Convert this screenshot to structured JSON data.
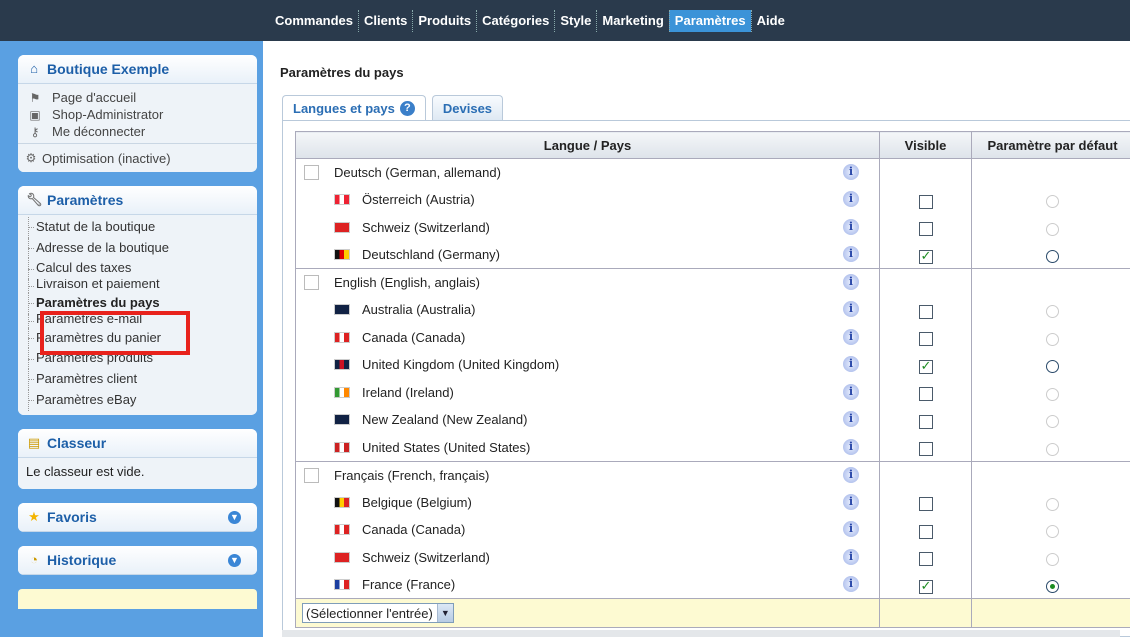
{
  "nav": {
    "items": [
      "Commandes",
      "Clients",
      "Produits",
      "Catégories",
      "Style",
      "Marketing",
      "Paramètres",
      "Aide"
    ],
    "active": "Paramètres"
  },
  "sidebar": {
    "shop": {
      "title": "Boutique Exemple",
      "links": [
        "Page d'accueil",
        "Shop-Administrator",
        "Me déconnecter"
      ],
      "optimisation": "Optimisation (inactive)"
    },
    "settings": {
      "title": "Paramètres",
      "items": [
        "Statut de la boutique",
        "Adresse de la boutique",
        "Calcul des taxes",
        "Livraison et paiement",
        "Paramètres du pays",
        "Paramètres e-mail",
        "Paramètres du panier",
        "Paramètres produits",
        "Paramètres client",
        "Paramètres eBay"
      ]
    },
    "binder": {
      "title": "Classeur",
      "empty_text": "Le classeur est vide."
    },
    "favorites": {
      "title": "Favoris"
    },
    "history": {
      "title": "Historique"
    }
  },
  "main": {
    "title": "Paramètres du pays",
    "tabs": [
      "Langues et pays",
      "Devises"
    ],
    "table": {
      "headers": [
        "Langue / Pays",
        "Visible",
        "Paramètre par défaut"
      ],
      "groups": [
        {
          "language": "Deutsch (German, allemand)",
          "countries": [
            {
              "name": "Österreich (Austria)",
              "visible": false,
              "default": false,
              "enabled": false,
              "flag": [
                "#e23",
                "#fff",
                "#e23"
              ]
            },
            {
              "name": "Schweiz (Switzerland)",
              "visible": false,
              "default": false,
              "enabled": false,
              "flag": [
                "#d22",
                "#d22",
                "#d22"
              ]
            },
            {
              "name": "Deutschland (Germany)",
              "visible": true,
              "default": false,
              "enabled": true,
              "flag": [
                "#111",
                "#d00",
                "#fc0"
              ]
            }
          ]
        },
        {
          "language": "English (English, anglais)",
          "countries": [
            {
              "name": "Australia (Australia)",
              "visible": false,
              "default": false,
              "enabled": false,
              "flag": [
                "#124",
                "#124",
                "#124"
              ]
            },
            {
              "name": "Canada (Canada)",
              "visible": false,
              "default": false,
              "enabled": false,
              "flag": [
                "#d22",
                "#fff",
                "#d22"
              ]
            },
            {
              "name": "United Kingdom (United Kingdom)",
              "visible": true,
              "default": false,
              "enabled": true,
              "flag": [
                "#124",
                "#c12",
                "#124"
              ]
            },
            {
              "name": "Ireland (Ireland)",
              "visible": false,
              "default": false,
              "enabled": false,
              "flag": [
                "#393",
                "#fff",
                "#f80"
              ]
            },
            {
              "name": "New Zealand (New Zealand)",
              "visible": false,
              "default": false,
              "enabled": false,
              "flag": [
                "#124",
                "#124",
                "#124"
              ]
            },
            {
              "name": "United States (United States)",
              "visible": false,
              "default": false,
              "enabled": false,
              "flag": [
                "#c22",
                "#fff",
                "#c22"
              ]
            }
          ]
        },
        {
          "language": "Français (French, français)",
          "countries": [
            {
              "name": "Belgique (Belgium)",
              "visible": false,
              "default": false,
              "enabled": false,
              "flag": [
                "#111",
                "#fc0",
                "#d22"
              ]
            },
            {
              "name": "Canada (Canada)",
              "visible": false,
              "default": false,
              "enabled": false,
              "flag": [
                "#d22",
                "#fff",
                "#d22"
              ]
            },
            {
              "name": "Schweiz (Switzerland)",
              "visible": false,
              "default": false,
              "enabled": false,
              "flag": [
                "#d22",
                "#d22",
                "#d22"
              ]
            },
            {
              "name": "France (France)",
              "visible": true,
              "default": true,
              "enabled": true,
              "flag": [
                "#1c3fa0",
                "#fff",
                "#d22"
              ]
            }
          ]
        }
      ],
      "select": {
        "value": "(Sélectionner l'entrée)"
      }
    }
  },
  "colors": {
    "nav_bg": "#2a3a4c",
    "nav_active": "#3b93d8",
    "sidebar_bg": "#5aa0e2",
    "link_blue": "#1d5fa8",
    "highlight_red": "#e8221c",
    "footer_row": "#fdfad2"
  }
}
